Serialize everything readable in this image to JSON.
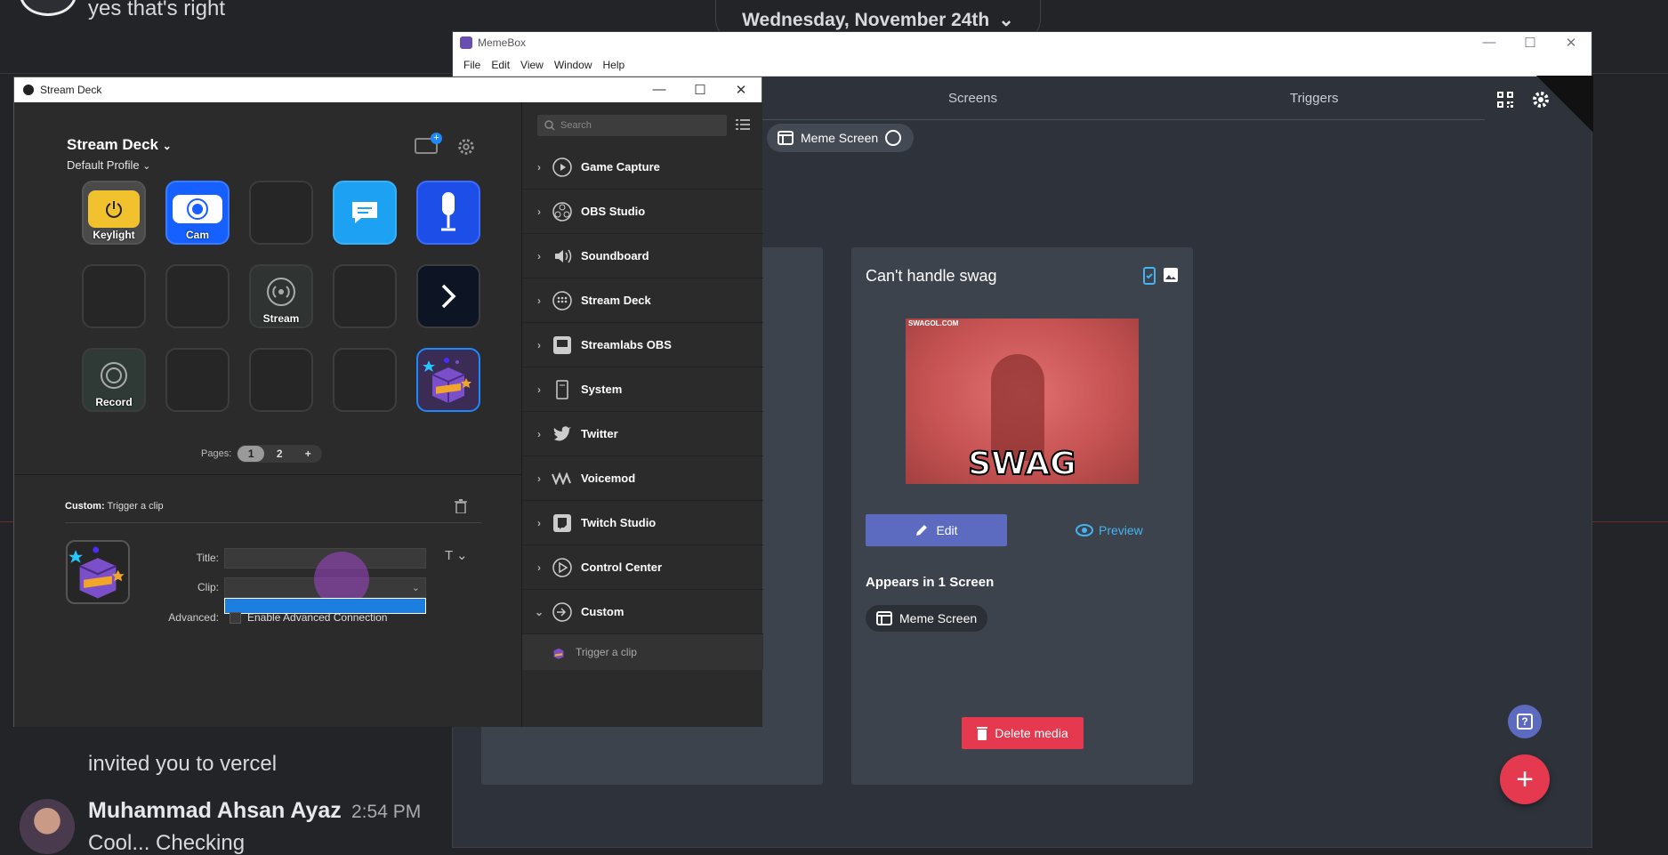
{
  "chat": {
    "top_message": "yes that's right",
    "date_divider": "Wednesday, November 24th",
    "faded_text": "invited",
    "invite_message": "invited you to vercel",
    "author": "Muhammad Ahsan Ayaz",
    "time": "2:54 PM",
    "message": "Cool... Checking"
  },
  "memebox": {
    "title": "MemeBox",
    "menu": [
      "File",
      "Edit",
      "View",
      "Window",
      "Help"
    ],
    "tabs": [
      "Screens",
      "Triggers"
    ],
    "screen_chip": "Meme Screen",
    "card": {
      "title": "Can't handle swag",
      "image_watermark": "SWAGOL.COM",
      "image_caption": "SWAG",
      "edit_label": "Edit",
      "preview_label": "Preview",
      "appears_label": "Appears in 1 Screen",
      "screen_chip": "Meme Screen",
      "delete_label": "Delete media"
    },
    "help_label": "?",
    "add_label": "+"
  },
  "streamdeck": {
    "title": "Stream Deck",
    "device": "Stream Deck",
    "profile": "Default Profile",
    "keys": [
      {
        "label": "Keylight",
        "icon": "power-icon"
      },
      {
        "label": "Cam",
        "icon": "camera-icon"
      },
      {
        "label": "",
        "icon": ""
      },
      {
        "label": "",
        "icon": "chat-icon"
      },
      {
        "label": "",
        "icon": "microphone-icon"
      },
      {
        "label": "",
        "icon": ""
      },
      {
        "label": "",
        "icon": ""
      },
      {
        "label": "Stream",
        "icon": "broadcast-icon"
      },
      {
        "label": "",
        "icon": ""
      },
      {
        "label": "",
        "icon": "chevron-right-icon"
      },
      {
        "label": "Record",
        "icon": "record-icon"
      },
      {
        "label": "",
        "icon": ""
      },
      {
        "label": "",
        "icon": ""
      },
      {
        "label": "",
        "icon": ""
      },
      {
        "label": "",
        "icon": "memebox-icon"
      }
    ],
    "pages_label": "Pages:",
    "pages": [
      "1",
      "2"
    ],
    "active_page": "1",
    "add_page": "+",
    "custom_label": "Custom:",
    "custom_action": "Trigger a clip",
    "title_label": "Title:",
    "clip_label": "Clip:",
    "advanced_label": "Advanced:",
    "advanced_option": "Enable Advanced Connection",
    "search_placeholder": "Search",
    "categories": [
      "Game Capture",
      "OBS Studio",
      "Soundboard",
      "Stream Deck",
      "Streamlabs OBS",
      "System",
      "Twitter",
      "Voicemod",
      "Twitch Studio",
      "Control Center",
      "Custom"
    ],
    "action_item": "Trigger a clip"
  },
  "colors": {
    "accent_blue": "#1e88ff",
    "memebox_primary": "#5c6bc0",
    "danger": "#e53950",
    "preview_link": "#44b3f0"
  }
}
